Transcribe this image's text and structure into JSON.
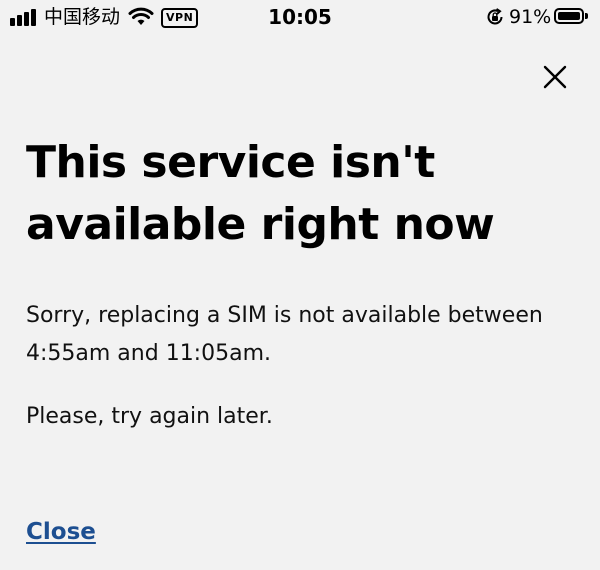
{
  "status_bar": {
    "carrier": "中国移动",
    "vpn_label": "VPN",
    "time": "10:05",
    "battery_percent": "91%",
    "battery_level": 0.91,
    "icons": [
      "signal-icon",
      "wifi-icon",
      "rotation-lock-icon",
      "battery-icon"
    ]
  },
  "dialog": {
    "close_icon": "close-icon",
    "title": "This service isn't available right now",
    "message": "Sorry, replacing a SIM is not available between 4:55am and 11:05am.",
    "retry_message": "Please, try again later.",
    "close_label": "Close",
    "link_color": "#1d4f91"
  }
}
